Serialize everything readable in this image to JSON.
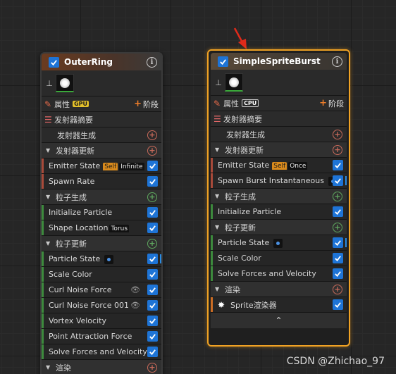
{
  "nodes": {
    "outer": {
      "title": "OuterRing",
      "props_label": "属性",
      "sim_target": "GPU",
      "stage_label": "阶段",
      "summary_label": "发射器摘要",
      "rows": [
        "发射器生成",
        "发射器更新",
        "Emitter State",
        "Self",
        "Infinite",
        "Spawn Rate",
        "粒子生成",
        "Initialize Particle",
        "Shape Location",
        "Torus",
        "粒子更新",
        "Particle State",
        "Scale Color",
        "Curl Noise Force",
        "Curl Noise Force 001",
        "Vortex Velocity",
        "Point Attraction Force",
        "Solve Forces and Velocity",
        "渲染"
      ]
    },
    "simple": {
      "title": "SimpleSpriteBurst",
      "props_label": "属性",
      "sim_target": "CPU",
      "stage_label": "阶段",
      "summary_label": "发射器摘要",
      "rows": [
        "发射器生成",
        "发射器更新",
        "Emitter State",
        "Self",
        "Once",
        "Spawn Burst Instantaneous",
        "粒子生成",
        "Initialize Particle",
        "粒子更新",
        "Particle State",
        "Scale Color",
        "Solve Forces and Velocity",
        "渲染",
        "Sprite渲染器"
      ]
    }
  },
  "watermark": "CSDN @Zhichao_97",
  "colors": {
    "selected_border": "#f0a224",
    "checkbox": "#1e74d6",
    "annotation_arrow": "#e02a1a"
  }
}
